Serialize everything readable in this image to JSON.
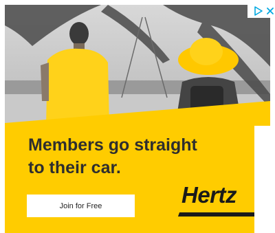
{
  "ad": {
    "headline_line1": "Members go straight",
    "headline_line2": "to their car.",
    "cta_label": "Join for Free",
    "logo_text": "Hertz",
    "adchoices_icon": "adchoices-play-icon",
    "close_icon": "close-icon"
  },
  "colors": {
    "brand_yellow": "#ffcc00",
    "text_dark": "#2e2e2e",
    "adchoices_blue": "#00a8e1"
  }
}
